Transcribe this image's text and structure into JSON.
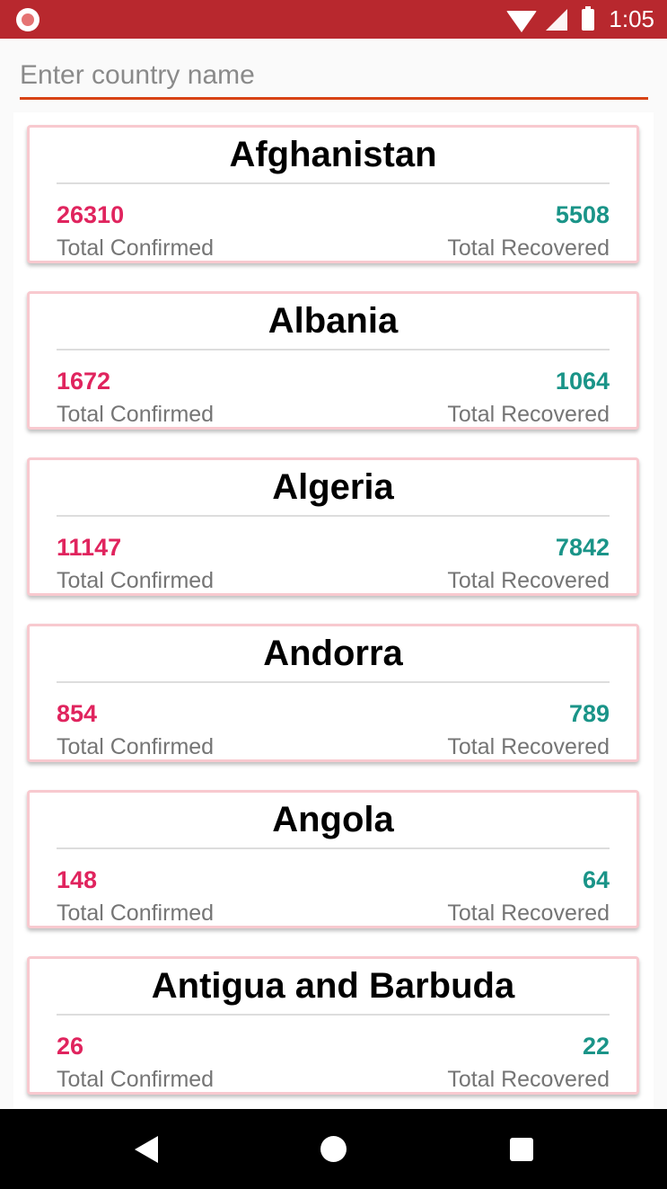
{
  "status_bar": {
    "time": "1:05",
    "color": "#b8282e"
  },
  "search": {
    "placeholder": "Enter country name",
    "value": ""
  },
  "labels": {
    "confirmed": "Total Confirmed",
    "recovered": "Total Recovered"
  },
  "colors": {
    "confirmed": "#e0245e",
    "recovered": "#1a9488",
    "search_underline": "#d84315"
  },
  "countries": [
    {
      "name": "Afghanistan",
      "confirmed": "26310",
      "recovered": "5508"
    },
    {
      "name": "Albania",
      "confirmed": "1672",
      "recovered": "1064"
    },
    {
      "name": "Algeria",
      "confirmed": "11147",
      "recovered": "7842"
    },
    {
      "name": "Andorra",
      "confirmed": "854",
      "recovered": "789"
    },
    {
      "name": "Angola",
      "confirmed": "148",
      "recovered": "64"
    },
    {
      "name": "Antigua and Barbuda",
      "confirmed": "26",
      "recovered": "22"
    }
  ],
  "nav": {
    "icons": [
      "back-icon",
      "home-icon",
      "recents-icon"
    ]
  }
}
